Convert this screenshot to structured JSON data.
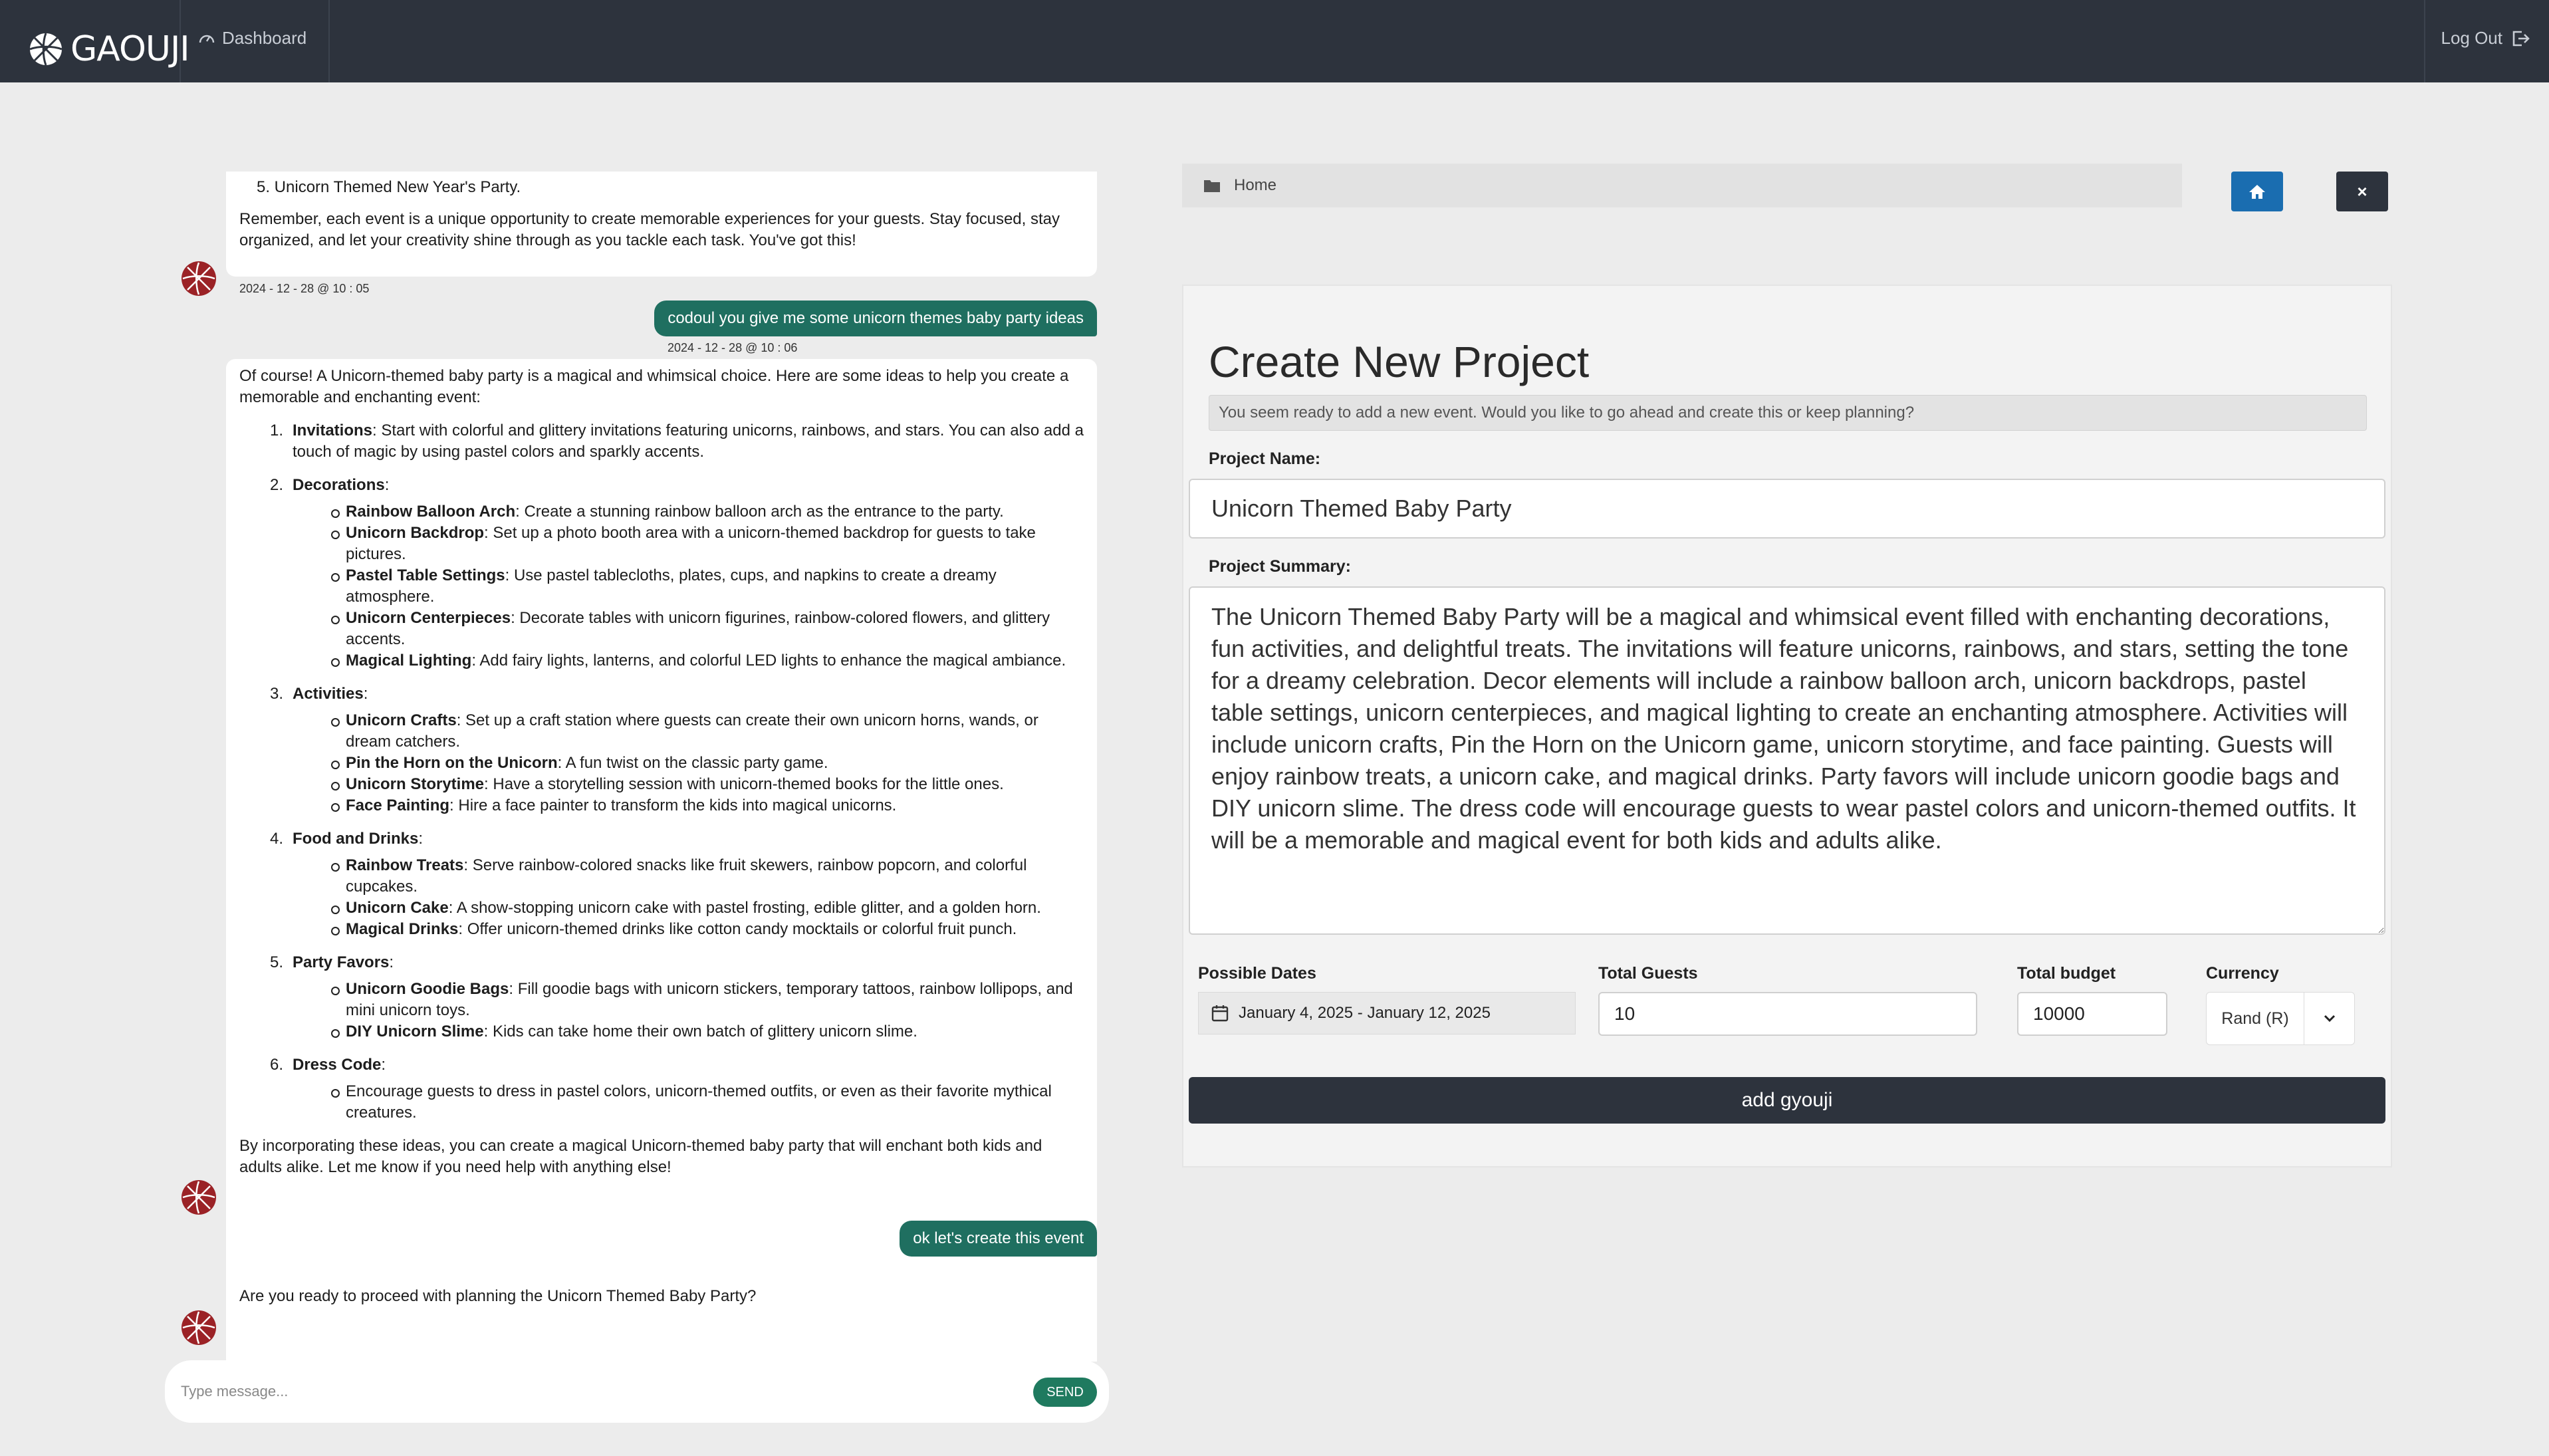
{
  "app": {
    "logo_text": "GAOUJI",
    "nav_dashboard": "Dashboard",
    "logout": "Log Out"
  },
  "chat": {
    "msg1": {
      "partial_item": "5. Unicorn Themed New Year's Party.",
      "closing": "Remember, each event is a unique opportunity to create memorable experiences for your guests. Stay focused, stay organized, and let your creativity shine through as you tackle each task. You've got this!",
      "timestamp": "2024 - 12 - 28 @ 10 : 05"
    },
    "user1": {
      "text": "codoul you give me some unicorn themes baby party ideas",
      "timestamp": "2024 - 12 - 28 @ 10 : 06"
    },
    "msg2": {
      "intro": "Of course! A Unicorn-themed baby party is a magical and whimsical choice. Here are some ideas to help you create a memorable and enchanting event:",
      "items": [
        {
          "num": "1.",
          "title": "Invitations",
          "text": ": Start with colorful and glittery invitations featuring unicorns, rainbows, and stars. You can also add a touch of magic by using pastel colors and sparkly accents.",
          "subs": []
        },
        {
          "num": "2.",
          "title": "Decorations",
          "text": ":",
          "subs": [
            {
              "title": "Rainbow Balloon Arch",
              "text": ": Create a stunning rainbow balloon arch as the entrance to the party."
            },
            {
              "title": "Unicorn Backdrop",
              "text": ": Set up a photo booth area with a unicorn-themed backdrop for guests to take pictures."
            },
            {
              "title": "Pastel Table Settings",
              "text": ": Use pastel tablecloths, plates, cups, and napkins to create a dreamy atmosphere."
            },
            {
              "title": "Unicorn Centerpieces",
              "text": ": Decorate tables with unicorn figurines, rainbow-colored flowers, and glittery accents."
            },
            {
              "title": "Magical Lighting",
              "text": ": Add fairy lights, lanterns, and colorful LED lights to enhance the magical ambiance."
            }
          ]
        },
        {
          "num": "3.",
          "title": "Activities",
          "text": ":",
          "subs": [
            {
              "title": "Unicorn Crafts",
              "text": ": Set up a craft station where guests can create their own unicorn horns, wands, or dream catchers."
            },
            {
              "title": "Pin the Horn on the Unicorn",
              "text": ": A fun twist on the classic party game."
            },
            {
              "title": "Unicorn Storytime",
              "text": ": Have a storytelling session with unicorn-themed books for the little ones."
            },
            {
              "title": "Face Painting",
              "text": ": Hire a face painter to transform the kids into magical unicorns."
            }
          ]
        },
        {
          "num": "4.",
          "title": "Food and Drinks",
          "text": ":",
          "subs": [
            {
              "title": "Rainbow Treats",
              "text": ": Serve rainbow-colored snacks like fruit skewers, rainbow popcorn, and colorful cupcakes."
            },
            {
              "title": "Unicorn Cake",
              "text": ": A show-stopping unicorn cake with pastel frosting, edible glitter, and a golden horn."
            },
            {
              "title": "Magical Drinks",
              "text": ": Offer unicorn-themed drinks like cotton candy mocktails or colorful fruit punch."
            }
          ]
        },
        {
          "num": "5.",
          "title": "Party Favors",
          "text": ":",
          "subs": [
            {
              "title": "Unicorn Goodie Bags",
              "text": ": Fill goodie bags with unicorn stickers, temporary tattoos, rainbow lollipops, and mini unicorn toys."
            },
            {
              "title": "DIY Unicorn Slime",
              "text": ": Kids can take home their own batch of glittery unicorn slime."
            }
          ]
        },
        {
          "num": "6.",
          "title": "Dress Code",
          "text": ":",
          "subs": [
            {
              "title": "",
              "text": "Encourage guests to dress in pastel colors, unicorn-themed outfits, or even as their favorite mythical creatures."
            }
          ]
        }
      ],
      "outro": "By incorporating these ideas, you can create a magical Unicorn-themed baby party that will enchant both kids and adults alike. Let me know if you need help with anything else!"
    },
    "user2": {
      "text": "ok let's create this event"
    },
    "msg3": {
      "text": "Are you ready to proceed with planning the Unicorn Themed Baby Party?"
    },
    "composer": {
      "placeholder": "Type message...",
      "send_label": "SEND"
    }
  },
  "project": {
    "breadcrumb": "Home",
    "close_label": "×",
    "title": "Create New Project",
    "notice": "You seem ready to add a new event. Would you like to go ahead and create this or keep planning?",
    "name_label": "Project Name:",
    "name_value": "Unicorn Themed Baby Party",
    "summary_label": "Project Summary:",
    "summary_value": "The Unicorn Themed Baby Party will be a magical and whimsical event filled with enchanting decorations, fun activities, and delightful treats. The invitations will feature unicorns, rainbows, and stars, setting the tone for a dreamy celebration. Decor elements will include a rainbow balloon arch, unicorn backdrops, pastel table settings, unicorn centerpieces, and magical lighting to create an enchanting atmosphere. Activities will include unicorn crafts, Pin the Horn on the Unicorn game, unicorn storytime, and face painting. Guests will enjoy rainbow treats, a unicorn cake, and magical drinks. Party favors will include unicorn goodie bags and DIY unicorn slime. The dress code will encourage guests to wear pastel colors and unicorn-themed outfits. It will be a memorable and magical event for both kids and adults alike.",
    "dates_label": "Possible Dates",
    "dates_value": "January 4, 2025 - January 12, 2025",
    "guests_label": "Total Guests",
    "guests_value": "10",
    "budget_label": "Total budget",
    "budget_value": "10000",
    "currency_label": "Currency",
    "currency_value": "Rand (R)",
    "submit_label": "add gyouji"
  },
  "colors": {
    "topbar": "#2d333d",
    "user_bubble": "#1f6f60",
    "home_button": "#1a6db0",
    "avatar": "#9b2226"
  }
}
